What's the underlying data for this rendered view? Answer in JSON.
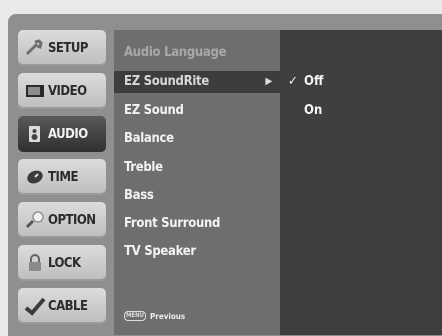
{
  "nav": [
    {
      "label": "SETUP",
      "icon": "wrench-icon",
      "active": false
    },
    {
      "label": "VIDEO",
      "icon": "tv-icon",
      "active": false
    },
    {
      "label": "AUDIO",
      "icon": "speaker-icon",
      "active": true
    },
    {
      "label": "TIME",
      "icon": "clock-icon",
      "active": false
    },
    {
      "label": "OPTION",
      "icon": "option-icon",
      "active": false
    },
    {
      "label": "LOCK",
      "icon": "lock-icon",
      "active": false
    },
    {
      "label": "CABLE",
      "icon": "check-icon",
      "active": false
    }
  ],
  "menu": {
    "items": [
      {
        "label": "Audio Language",
        "state": "dim"
      },
      {
        "label": "EZ SoundRite",
        "state": "selected",
        "arrow": "▶"
      },
      {
        "label": "EZ Sound",
        "state": "normal"
      },
      {
        "label": "Balance",
        "state": "normal"
      },
      {
        "label": "Treble",
        "state": "normal"
      },
      {
        "label": "Bass",
        "state": "normal"
      },
      {
        "label": "Front Surround",
        "state": "normal"
      },
      {
        "label": "TV Speaker",
        "state": "normal"
      }
    ],
    "previous_button": "MENU",
    "previous_label": "Previous"
  },
  "submenu": {
    "items": [
      {
        "label": "Off",
        "checked": true,
        "check": "✓"
      },
      {
        "label": "On",
        "checked": false,
        "check": ""
      }
    ]
  },
  "colors": {
    "background": "#e9e9e9",
    "menu": "#6e6e6e",
    "submenu": "#3f3f3f",
    "nav": "#cfcfcf",
    "nav_active": "#3a3a3a"
  }
}
